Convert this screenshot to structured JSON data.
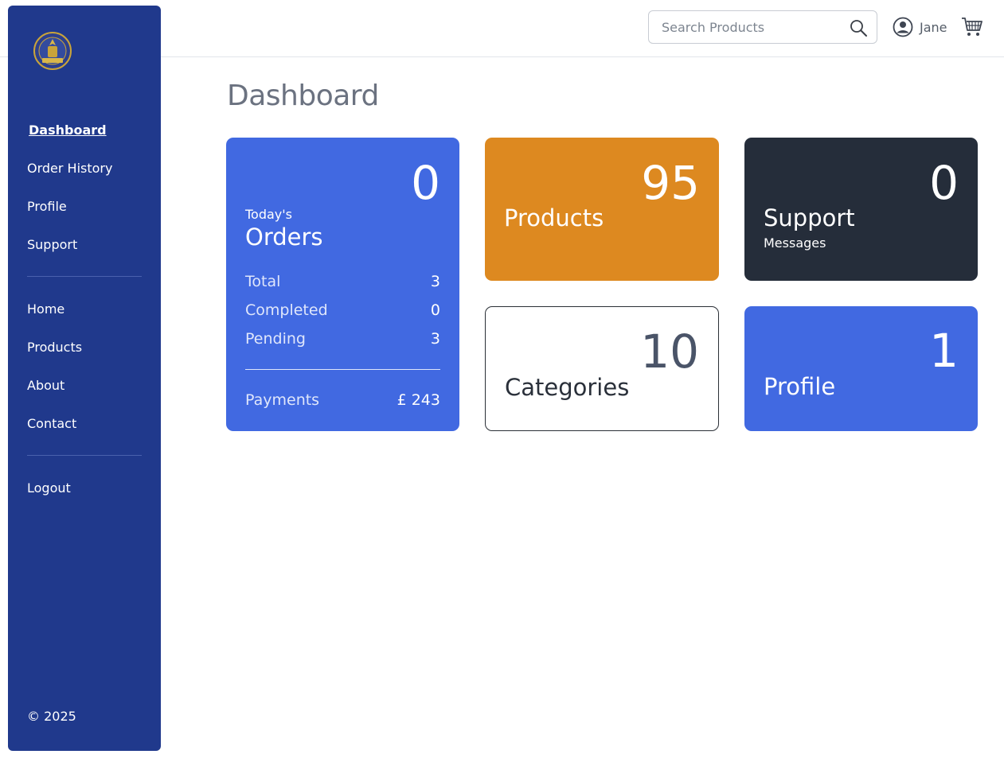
{
  "header": {
    "search": {
      "placeholder": "Search Products",
      "value": ""
    },
    "user_name": "Jane"
  },
  "sidebar": {
    "nav_primary": [
      "Dashboard",
      "Order History",
      "Profile",
      "Support"
    ],
    "nav_secondary": [
      "Home",
      "Products",
      "About",
      "Contact"
    ],
    "logout": "Logout",
    "copyright": "© 2025",
    "active_item": "Dashboard"
  },
  "main": {
    "title": "Dashboard",
    "orders_card": {
      "count": "0",
      "label_small": "Today's",
      "label": "Orders",
      "stats": [
        {
          "label": "Total",
          "value": "3"
        },
        {
          "label": "Completed",
          "value": "0"
        },
        {
          "label": "Pending",
          "value": "3"
        }
      ],
      "payments_label": "Payments",
      "payments_value": "£ 243"
    },
    "products_card": {
      "count": "95",
      "label": "Products"
    },
    "support_card": {
      "count": "0",
      "label": "Support",
      "sublabel": "Messages"
    },
    "categories_card": {
      "count": "10",
      "label": "Categories"
    },
    "profile_card": {
      "count": "1",
      "label": "Profile"
    }
  },
  "colors": {
    "sidebar": "#20398c",
    "blue_card": "#4169e1",
    "orange_card": "#dd8920",
    "dark_card": "#252d3a"
  },
  "icons": [
    "logo",
    "search-icon",
    "user-avatar-icon",
    "cart-icon"
  ]
}
